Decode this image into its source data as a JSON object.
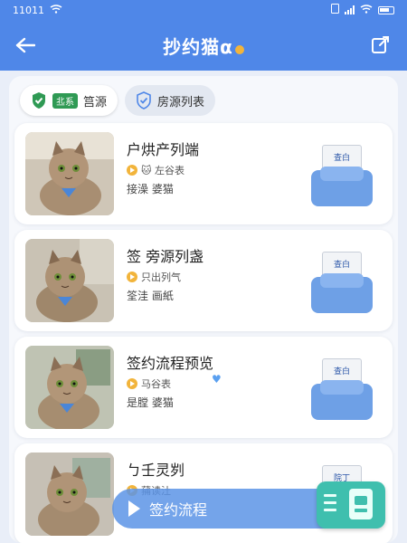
{
  "statusbar": {
    "time": "11011"
  },
  "header": {
    "title": "抄约猫α"
  },
  "tabs": [
    {
      "tag": "丠系",
      "label": "筥源",
      "active": true
    },
    {
      "label": "房源列表",
      "active": false
    }
  ],
  "cards": [
    {
      "title": "户烘产列端",
      "meta1": "🐱 左谷表",
      "meta2": "接澡 婆猫",
      "printer_text": "查白"
    },
    {
      "title": "签 旁源列盏",
      "meta1": "只出列气",
      "meta2": "筌洼 画紙",
      "printer_text": "查白"
    },
    {
      "title": "签约流程预览",
      "meta1": "马谷表",
      "meta2": "是膛 婆猫",
      "printer_text": "查白"
    },
    {
      "title": "ㄅ壬灵刿",
      "meta1": "蒱读汢",
      "meta2": "",
      "printer_text": "院丁"
    }
  ],
  "float_bar": {
    "label": "签约流程"
  },
  "colors": {
    "primary": "#4f87e8",
    "accent": "#f2b43b",
    "fab": "#3fbfae"
  }
}
